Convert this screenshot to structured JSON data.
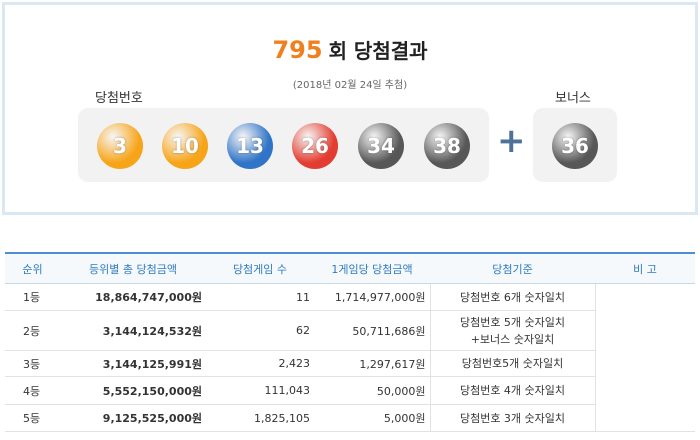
{
  "header": {
    "round": "795",
    "title_suffix": "회 당첨결과",
    "draw_date": "(2018년 02월 24일 추첨)",
    "winning_label": "당첨번호",
    "bonus_label": "보너스"
  },
  "winning_numbers": [
    {
      "value": "3",
      "color": "#f7a418"
    },
    {
      "value": "10",
      "color": "#f7a418"
    },
    {
      "value": "13",
      "color": "#2f74c7"
    },
    {
      "value": "26",
      "color": "#e33d31"
    },
    {
      "value": "34",
      "color": "#575757"
    },
    {
      "value": "38",
      "color": "#575757"
    }
  ],
  "plus_symbol": "+",
  "bonus_number": {
    "value": "36",
    "color": "#575757"
  },
  "table": {
    "headers": [
      "순위",
      "등위별 총 당첨금액",
      "당첨게임 수",
      "1게임당 당첨금액",
      "당첨기준",
      "비 고"
    ],
    "rows": [
      {
        "rank": "1등",
        "total": "18,864,747,000원",
        "games": "11",
        "per_game": "1,714,977,000원",
        "criteria": [
          "당첨번호 6개 숫자일치"
        ]
      },
      {
        "rank": "2등",
        "total": "3,144,124,532원",
        "games": "62",
        "per_game": "50,711,686원",
        "criteria": [
          "당첨번호 5개 숫자일치",
          "+보너스 숫자일치"
        ]
      },
      {
        "rank": "3등",
        "total": "3,144,125,991원",
        "games": "2,423",
        "per_game": "1,297,617원",
        "criteria": [
          "당첨번호5개 숫자일치"
        ]
      },
      {
        "rank": "4등",
        "total": "5,552,150,000원",
        "games": "111,043",
        "per_game": "50,000원",
        "criteria": [
          "당첨번호 4개 숫자일치"
        ]
      },
      {
        "rank": "5등",
        "total": "9,125,525,000원",
        "games": "1,825,105",
        "per_game": "5,000원",
        "criteria": [
          "당첨번호 3개 숫자일치"
        ]
      }
    ]
  }
}
